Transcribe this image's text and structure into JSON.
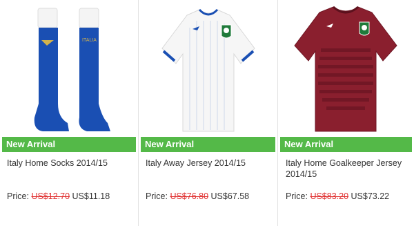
{
  "products": [
    {
      "badge": "New Arrival",
      "name": "Italy Home Socks 2014/15",
      "price_label": "Price:",
      "old_price": "US$12.70",
      "new_price": "US$11.18",
      "image_icon": "socks-icon",
      "sock_text": "ITALIA"
    },
    {
      "badge": "New Arrival",
      "name": "Italy Away Jersey 2014/15",
      "price_label": "Price:",
      "old_price": "US$76.80",
      "new_price": "US$67.58",
      "image_icon": "white-jersey-icon"
    },
    {
      "badge": "New Arrival",
      "name": "Italy Home Goalkeeper Jersey 2014/15",
      "price_label": "Price:",
      "old_price": "US$83.20",
      "new_price": "US$73.22",
      "image_icon": "goalkeeper-jersey-icon"
    }
  ],
  "colors": {
    "badge_bg": "#54b948",
    "old_price": "#e03030",
    "sock_blue": "#1a4fb3",
    "keeper_red": "#8a1f2e"
  }
}
